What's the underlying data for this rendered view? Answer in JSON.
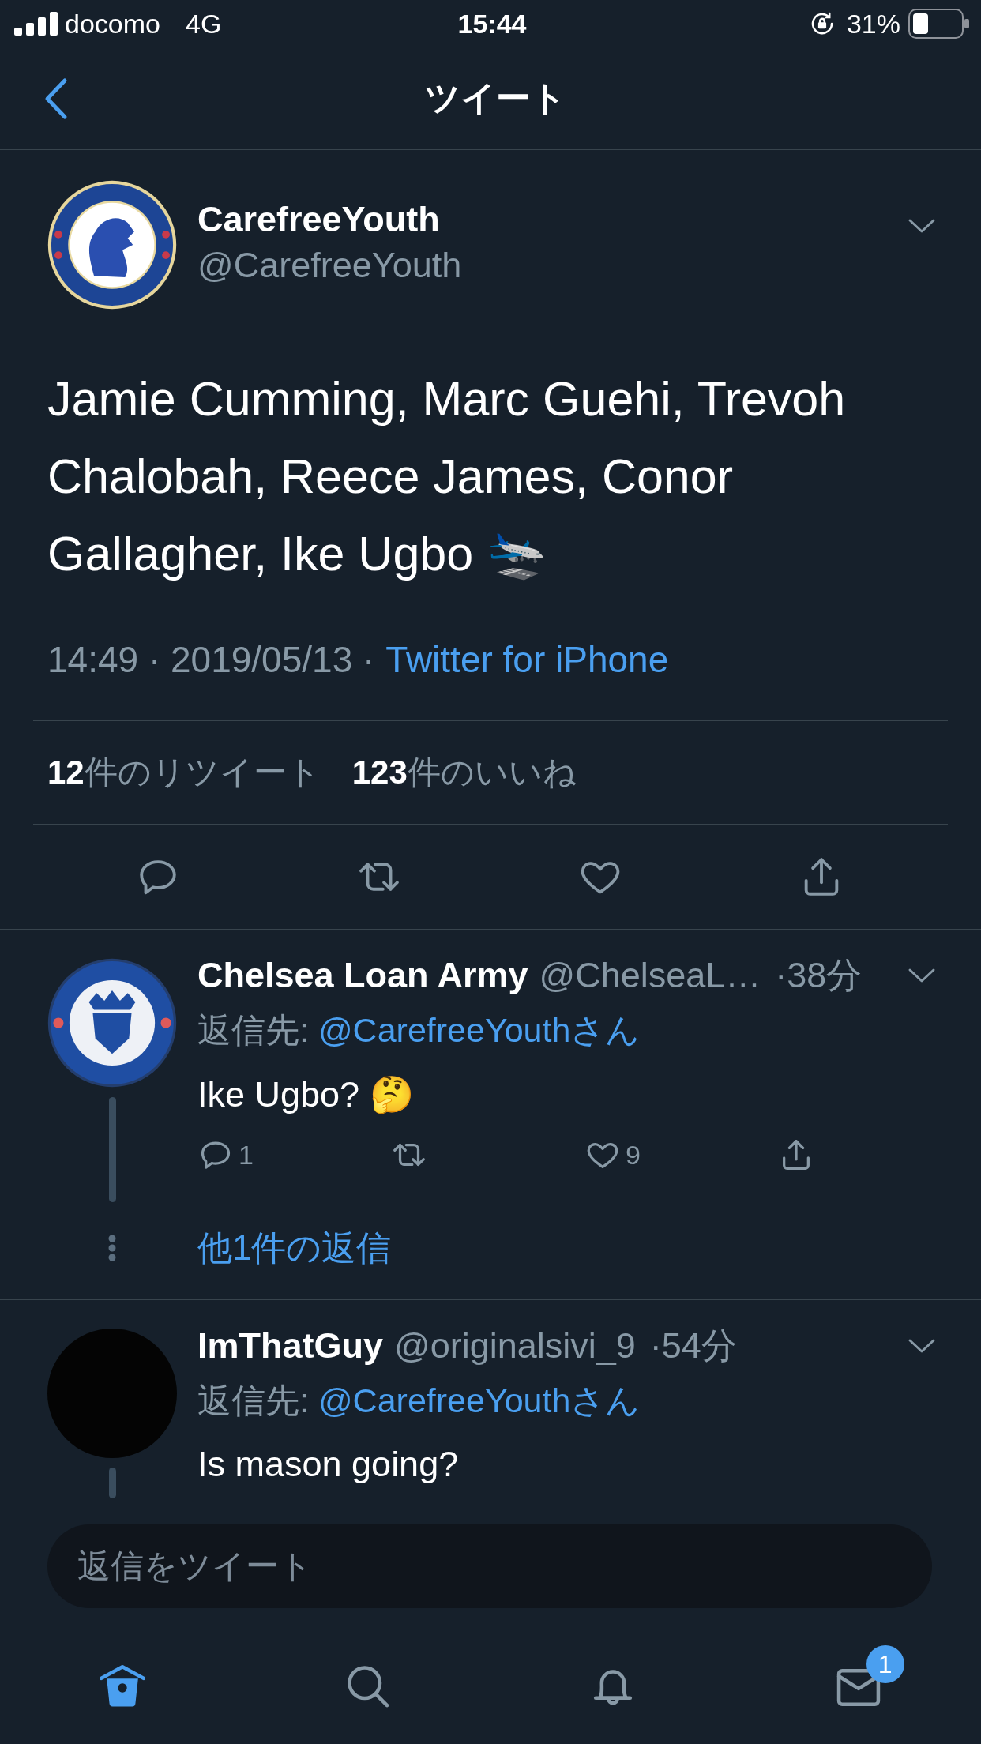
{
  "status_bar": {
    "carrier": "docomo",
    "network": "4G",
    "time": "15:44",
    "battery": "31%"
  },
  "nav": {
    "title": "ツイート"
  },
  "tweet": {
    "avatar": {
      "kind": "crest"
    },
    "name": "CarefreeYouth",
    "handle": "@CarefreeYouth",
    "text": "Jamie Cumming, Marc Guehi, Trevoh Chalobah, Reece James, Conor Gallagher, Ike Ugbo 🛬",
    "timestamp": "14:49 · 2019/05/13 ·",
    "source": "Twitter for iPhone",
    "stats": [
      {
        "count": "12",
        "label": "件のリツイート"
      },
      {
        "count": "123",
        "label": "件のいいね"
      }
    ]
  },
  "replies": [
    {
      "avatar": {
        "kind": "crest"
      },
      "name": "Chelsea Loan Army",
      "handle": "@ChelseaL…",
      "time": "·38分",
      "reply_to_label": "返信先:",
      "reply_to": "@CarefreeYouthさん",
      "text": "Ike Ugbo? 🤔",
      "actions": {
        "reply_count": "1",
        "like_count": "9"
      },
      "threaded": true,
      "more_replies": "他1件の返信"
    },
    {
      "avatar": {
        "kind": "plain"
      },
      "name": "ImThatGuy",
      "handle": "@originalsivi_9",
      "time": "·54分",
      "reply_to_label": "返信先:",
      "reply_to": "@CarefreeYouthさん",
      "text": "Is mason going?",
      "threaded": true
    }
  ],
  "composer": {
    "placeholder": "返信をツイート"
  },
  "tabs": [
    {
      "selected": true
    },
    {
      "selected": false
    },
    {
      "selected": false
    },
    {
      "selected": false,
      "badge": "1"
    }
  ]
}
